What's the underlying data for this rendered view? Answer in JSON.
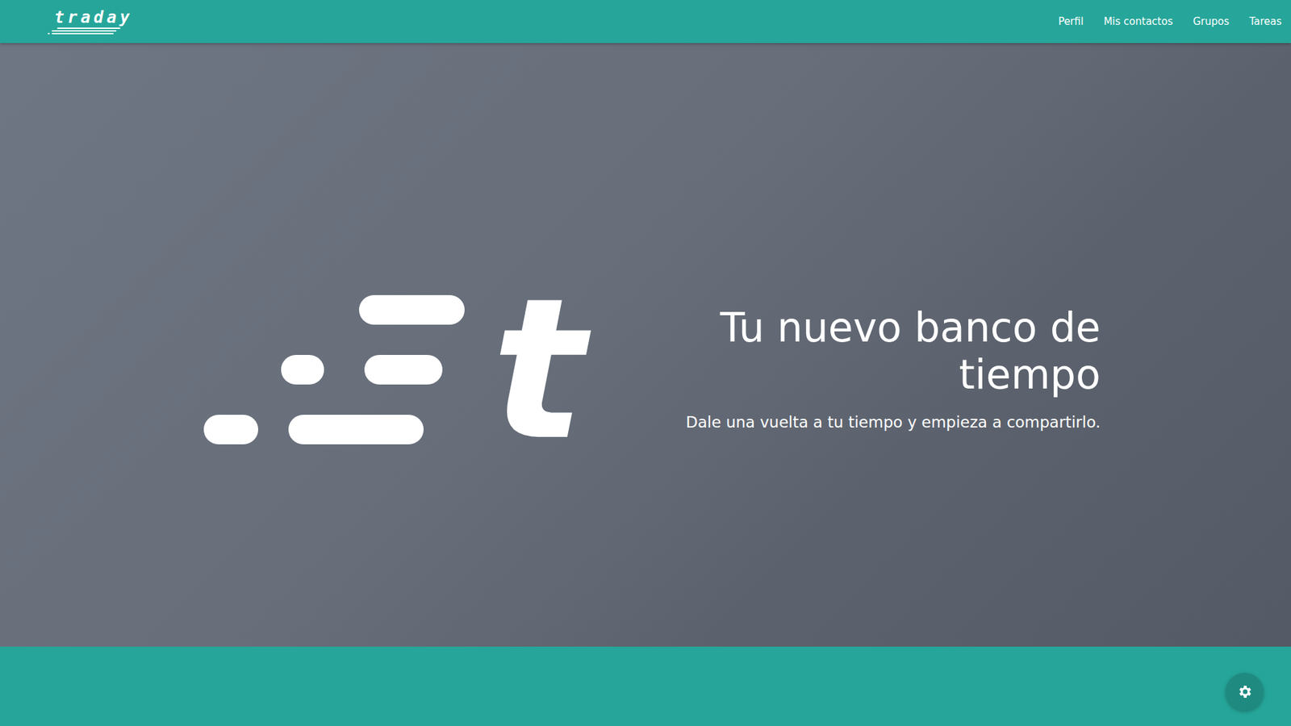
{
  "navbar": {
    "logo": "traday",
    "links": [
      "Perfil",
      "Mis contactos",
      "Grupos",
      "Tareas"
    ]
  },
  "hero": {
    "mark": "t",
    "title": "Tu nuevo banco de tiempo",
    "subtitle": "Dale una vuelta a tu tiempo y empieza a compartirlo."
  }
}
